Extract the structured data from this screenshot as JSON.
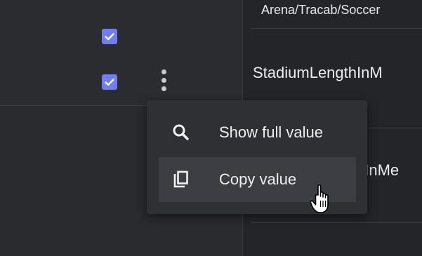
{
  "table": {
    "column_header_partial": "Arena/Tracab/Soccer",
    "rows": [
      {
        "checked": true,
        "cell_partial": "StadiumLengthInM"
      },
      {
        "checked": true,
        "cell_partial": "hInMe"
      }
    ]
  },
  "context_menu": {
    "items": [
      {
        "icon": "search-icon",
        "label": "Show full value"
      },
      {
        "icon": "copy-icon",
        "label": "Copy value"
      }
    ]
  },
  "colors": {
    "checkbox": "#6f7ef2",
    "menu_background": "#2f3034",
    "menu_hover": "#3d3e43",
    "text": "#eeeeee"
  }
}
